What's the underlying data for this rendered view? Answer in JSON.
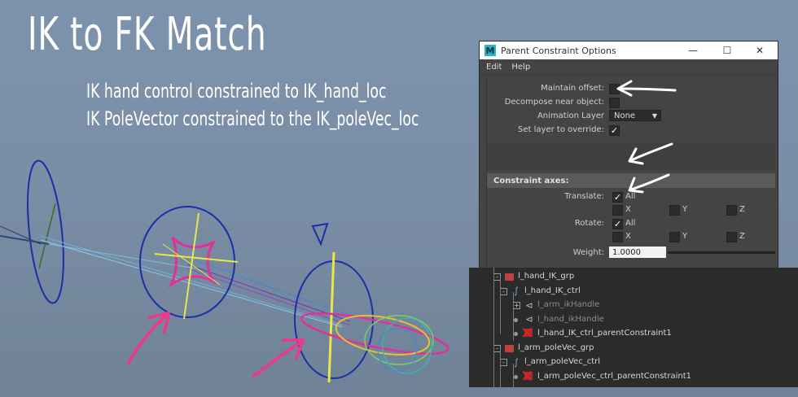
{
  "slide": {
    "title": "IK to FK Match",
    "lines": [
      "IK hand control constrained to IK_hand_loc",
      "IK PoleVector constrained to the IK_poleVec_loc"
    ]
  },
  "dialog": {
    "app_icon": "M",
    "title": "Parent Constraint Options",
    "window_controls": [
      "minimize-icon",
      "maximize-icon",
      "close-icon"
    ],
    "menu": [
      "Edit",
      "Help"
    ],
    "options": {
      "maintain_offset_label": "Maintain offset:",
      "maintain_offset": false,
      "decompose_label": "Decompose near object:",
      "decompose": false,
      "animation_layer_label": "Animation Layer",
      "animation_layer_value": "None",
      "set_layer_label": "Set layer to override:",
      "set_layer": true
    },
    "constraint_axes": {
      "header": "Constraint axes:",
      "translate_label": "Translate:",
      "rotate_label": "Rotate:",
      "all_label": "All",
      "x_label": "X",
      "y_label": "Y",
      "z_label": "Z",
      "translate_all": true,
      "rotate_all": true
    },
    "weight": {
      "label": "Weight:",
      "value": "1.0000"
    }
  },
  "outliner": {
    "rows": [
      {
        "name": "l_hand_IK_grp",
        "icon": "group-icon",
        "expand": "−",
        "dim": false,
        "red_x": false
      },
      {
        "name": "l_hand_IK_ctrl",
        "icon": "curve-icon",
        "expand": "−",
        "dim": false,
        "red_x": false
      },
      {
        "name": "l_arm_ikHandle",
        "icon": "ikhandle-icon",
        "expand": "+",
        "dim": true,
        "red_x": false
      },
      {
        "name": "l_hand_ikHandle",
        "icon": "ikhandle-icon",
        "expand": "",
        "dim": true,
        "red_x": false
      },
      {
        "name": "l_hand_IK_ctrl_parentConstraint1",
        "icon": "constraint-icon",
        "expand": "",
        "dim": false,
        "red_x": true
      },
      {
        "name": "l_arm_poleVec_grp",
        "icon": "group-icon",
        "expand": "−",
        "dim": false,
        "red_x": false
      },
      {
        "name": "l_arm_poleVec_ctrl",
        "icon": "curve-icon",
        "expand": "−",
        "dim": false,
        "red_x": false
      },
      {
        "name": "l_arm_poleVec_ctrl_parentConstraint1",
        "icon": "constraint-icon",
        "expand": "",
        "dim": false,
        "red_x": true
      }
    ]
  },
  "colors": {
    "background": "#7a8ea6",
    "annotation_arrow": "#e63d8a",
    "control_circle": "#1a2fa8",
    "ik_yellow": "#e8e84a",
    "star_pink": "#e0309a",
    "maya_panel": "#444444",
    "outliner_bg": "#2b2b2b",
    "constraint_x": "#e02020"
  }
}
